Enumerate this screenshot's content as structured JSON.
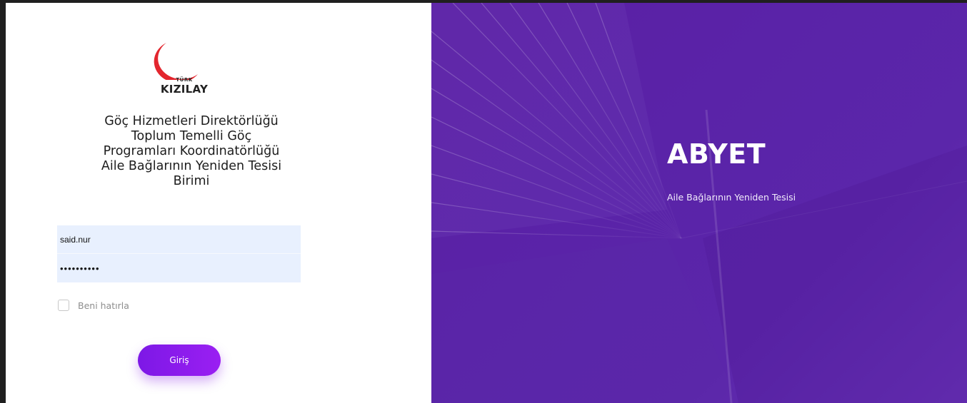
{
  "branding": {
    "logo_small_text": "TÜRK",
    "logo_main_text": "KIZILAY",
    "logo_color": "#e3262e"
  },
  "org_title_lines": [
    "Göç Hizmetleri Direktörlüğü",
    "Toplum Temelli Göç",
    "Programları Koordinatörlüğü",
    "Aile Bağlarının Yeniden Tesisi",
    "Birimi"
  ],
  "login": {
    "username_value": "said.nur",
    "password_value": "••••••••••",
    "remember_label": "Beni hatırla",
    "remember_checked": false,
    "submit_label": "Giriş"
  },
  "hero": {
    "title": "ABYET",
    "subtitle": "Aile Bağlarının Yeniden Tesisi",
    "background_color": "#5b23a8"
  },
  "colors": {
    "accent": "#8a1cec",
    "input_bg": "#e8f0fe"
  }
}
